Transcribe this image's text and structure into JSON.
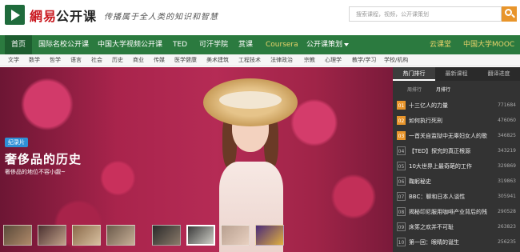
{
  "header": {
    "logo_trad": "網易",
    "logo_simp": "公开课",
    "slogan": "传播属于全人类的知识和智慧",
    "search_placeholder": "搜索课程，视频，公开课策划"
  },
  "nav": {
    "items": [
      "首页",
      "国际名校公开课",
      "中国大学视频公开课",
      "TED",
      "可汗学院",
      "赏课",
      "Coursera",
      "公开课策划",
      "云课堂",
      "中国大学MOOC"
    ],
    "highlight_color": "#e8d36a"
  },
  "subnav": [
    "文学",
    "数学",
    "哲学",
    "语言",
    "社会",
    "历史",
    "商业",
    "传媒",
    "医学健康",
    "美术建筑",
    "工程技术",
    "法律政治",
    "宗教",
    "心理学",
    "教学/学习",
    "学校/机构"
  ],
  "hero": {
    "badge": "纪录片",
    "title": "奢侈品的历史",
    "subtitle": "奢侈品的地位不容小觑~"
  },
  "panel": {
    "tabs": [
      "热门排行",
      "最新课程",
      "翻译进度"
    ],
    "subtabs": [
      "周排行",
      "月排行"
    ],
    "rankings": [
      {
        "num": "01",
        "title": "十三亿人的力量",
        "count": "771684"
      },
      {
        "num": "02",
        "title": "如何执行死刑",
        "count": "476060"
      },
      {
        "num": "03",
        "title": "一首关自监狱中无辜妇女人的歌",
        "count": "346825"
      },
      {
        "num": "04",
        "title": "【TED】探究的真正根源",
        "count": "343219"
      },
      {
        "num": "05",
        "title": "10大世界上最奇葩的工作",
        "count": "329869"
      },
      {
        "num": "06",
        "title": "鞠躬秘史",
        "count": "319863"
      },
      {
        "num": "07",
        "title": "BBC：聊和日本人谈性",
        "count": "305941"
      },
      {
        "num": "08",
        "title": "揭秘印尼服用咖啡产业背后的残酷",
        "count": "290528"
      },
      {
        "num": "09",
        "title": "床笫之欢并不可耻",
        "count": "263823"
      },
      {
        "num": "10",
        "title": "第一回：眼睛的诞生",
        "count": "256235"
      }
    ]
  },
  "colors": {
    "brand_green": "#2b7a3f",
    "accent_orange": "#e8952b",
    "logo_red": "#c9171e"
  }
}
